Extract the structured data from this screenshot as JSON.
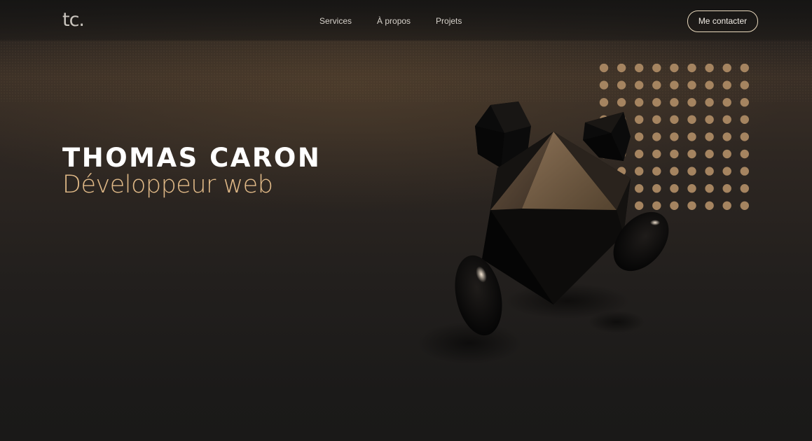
{
  "navbar": {
    "logo": "tc.",
    "links": [
      {
        "label": "Services"
      },
      {
        "label": "À propos"
      },
      {
        "label": "Projets"
      }
    ],
    "contact_label": "Me contacter"
  },
  "hero": {
    "name": "THOMAS CARON",
    "role": "Développeur web"
  },
  "colors": {
    "accent": "#e0b987",
    "dot": "#a58460",
    "background": "#1b1a19"
  },
  "decor": {
    "dot_grid": {
      "rows": 9,
      "cols": 9
    },
    "illustration_icon": "3d-geometric-character"
  }
}
